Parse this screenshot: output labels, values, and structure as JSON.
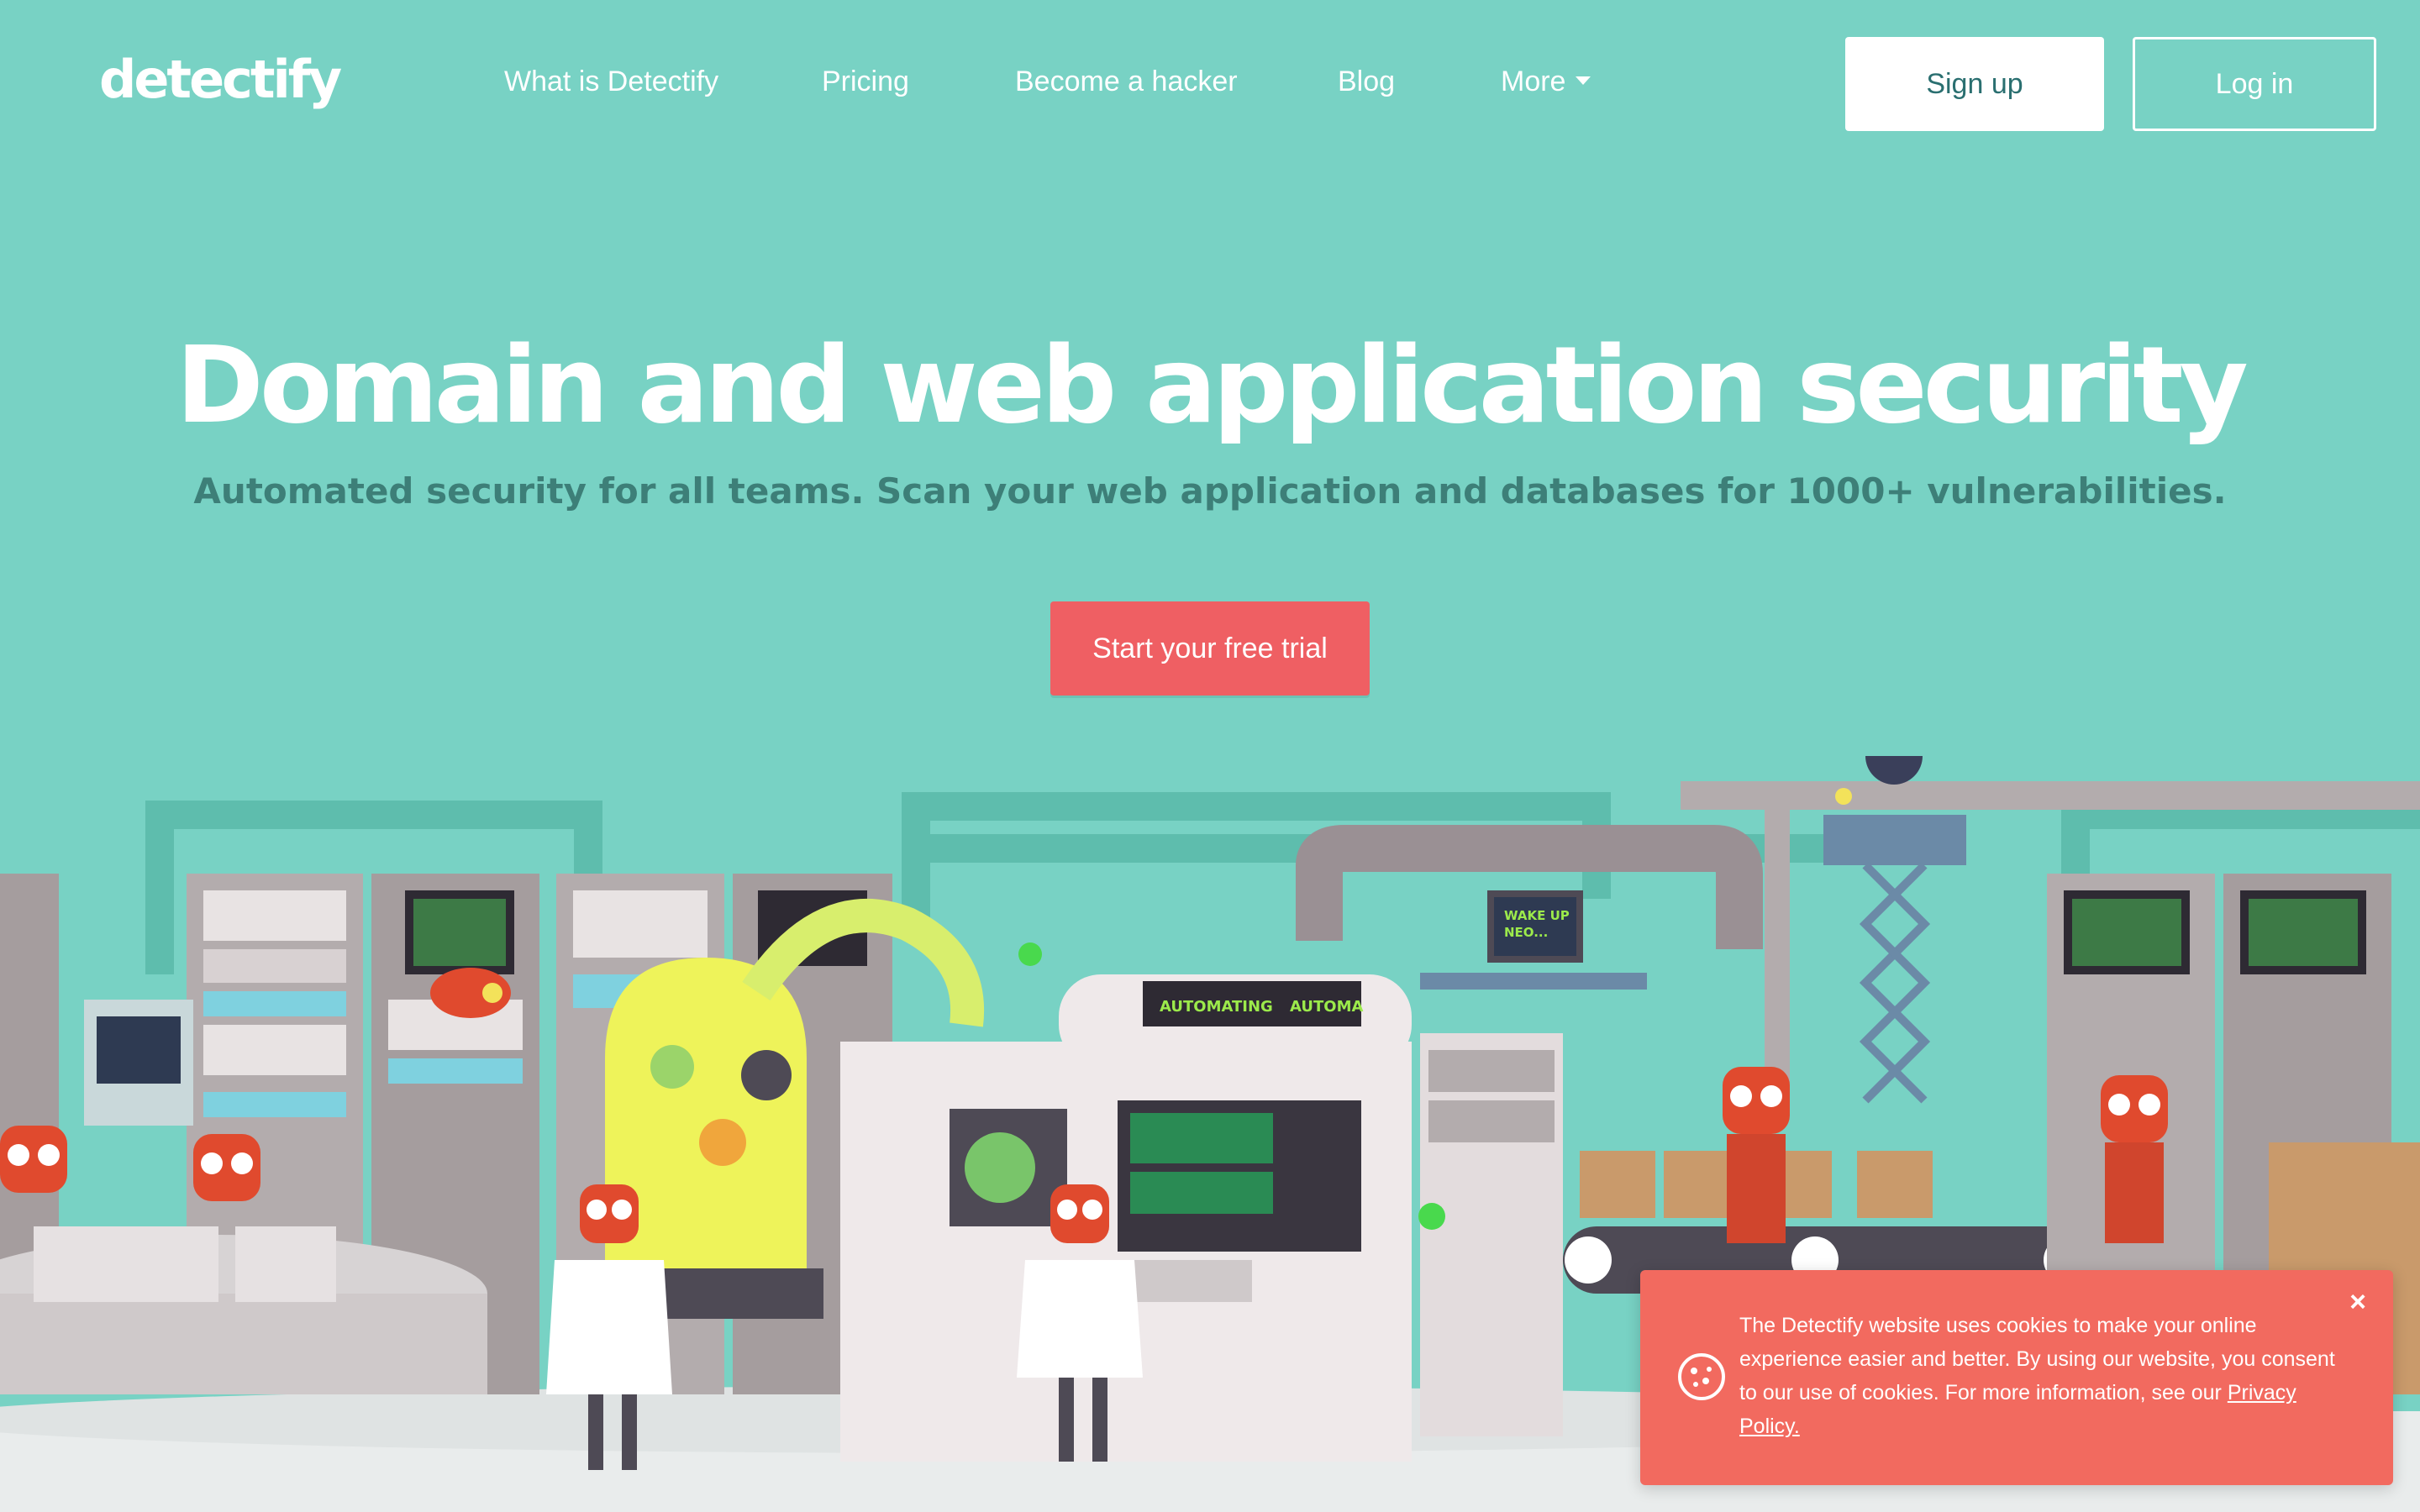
{
  "brand": {
    "logo_text": "detectify"
  },
  "nav": {
    "links": [
      "What is Detectify",
      "Pricing",
      "Become a hacker",
      "Blog",
      "More"
    ],
    "signup_label": "Sign up",
    "login_label": "Log in"
  },
  "hero": {
    "title": "Domain and web application security",
    "subtitle": "Automated security for all teams. Scan your web application and databases for 1000+ vulnerabilities.",
    "cta_label": "Start your free trial"
  },
  "illustration": {
    "screen_text": "AUTOMATING",
    "screen_text_2": "AUTOMA",
    "monitor_line_1": "WAKE UP",
    "monitor_line_2": "NEO..."
  },
  "cookie_banner": {
    "text": "The Detectify website uses cookies to make your online experience easier and better. By using our website, you consent to our use of cookies. For more information, see our ",
    "link_text": "Privacy Policy.",
    "close_label": "×"
  },
  "colors": {
    "background": "#78d2c4",
    "cta": "#ef5f63",
    "cookie_bg": "#f26a5f",
    "subtitle": "#3d7f78"
  }
}
